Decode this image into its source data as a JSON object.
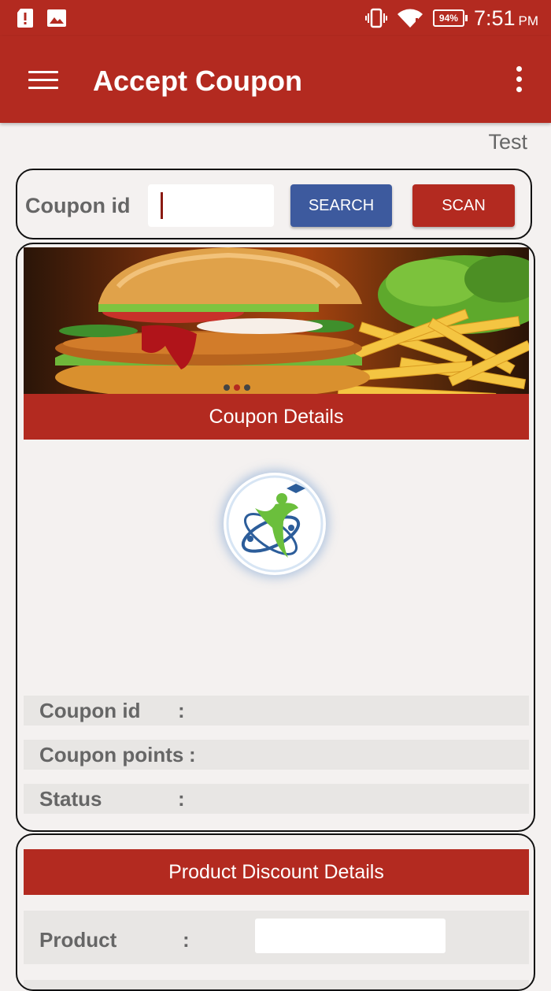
{
  "status_bar": {
    "time": "7:51",
    "ampm": "PM",
    "battery": "94%",
    "icons": [
      "sd-card-alert-icon",
      "image-icon",
      "vibrate-icon",
      "wifi-icon",
      "battery-icon"
    ]
  },
  "app_bar": {
    "title": "Accept Coupon",
    "menu_icon": "hamburger-menu-icon",
    "overflow_icon": "more-vert-icon"
  },
  "test_label": "Test",
  "search": {
    "label": "Coupon id",
    "input_value": "",
    "search_button": "SEARCH",
    "scan_button": "SCAN"
  },
  "details": {
    "header": "Coupon Details",
    "rows": [
      {
        "label": "Coupon id",
        "colon": ":",
        "value": ""
      },
      {
        "label": "Coupon points",
        "colon": ":",
        "value": ""
      },
      {
        "label": "Status",
        "colon": ":",
        "value": ""
      }
    ]
  },
  "product": {
    "header": "Product Discount Details",
    "label": "Product",
    "colon": ":",
    "value": ""
  },
  "colors": {
    "primary": "#b32a20",
    "search_button": "#3d5a9e",
    "background": "#f4f1f0"
  }
}
